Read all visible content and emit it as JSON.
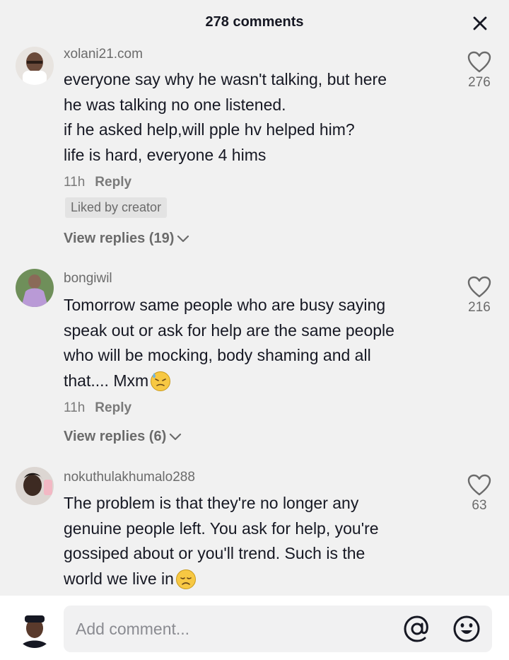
{
  "header": {
    "title": "278 comments",
    "close_icon": "close-icon"
  },
  "comments": [
    {
      "username": "xolani21.com",
      "lines": [
        "everyone say why he wasn't talking, but here",
        "he was talking no one listened.",
        "if he asked help,will pple hv helped him?",
        "life is hard, everyone 4 hims"
      ],
      "time": "11h",
      "reply_label": "Reply",
      "badge": "Liked by creator",
      "view_replies": "View replies (19)",
      "likes": "276"
    },
    {
      "username": "bongiwil",
      "lines": [
        "Tomorrow same people who are busy saying",
        "speak out or ask for help are the same people",
        "who will be mocking, body shaming and all",
        "that.... Mxm"
      ],
      "emoji": "downcast-sweat-emoji",
      "time": "11h",
      "reply_label": "Reply",
      "view_replies": "View replies (6)",
      "likes": "216"
    },
    {
      "username": "nokuthulakhumalo288",
      "lines": [
        "The problem is that they're no longer any",
        "genuine people left. You ask for help, you're",
        "gossiped about or you'll trend. Such is the",
        "world we live in"
      ],
      "emoji": "disappointed-emoji",
      "likes": "63"
    }
  ],
  "footer": {
    "placeholder": "Add comment...",
    "mention_icon": "at-icon",
    "emoji_icon": "smiley-icon"
  },
  "colors": {
    "background": "#f1f1f1",
    "text": "#161823",
    "secondary": "#6b6b6b",
    "emoji": "#f7c843"
  }
}
